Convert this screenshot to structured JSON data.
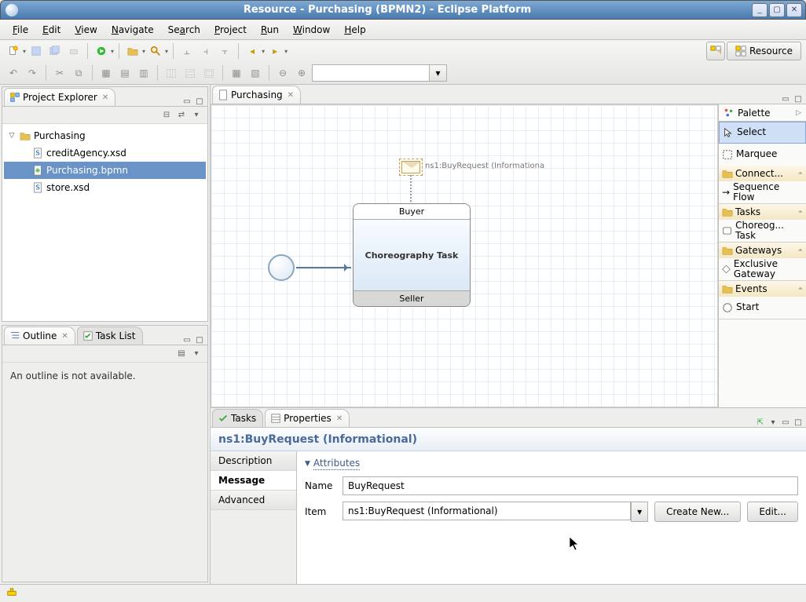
{
  "window": {
    "title": "Resource - Purchasing (BPMN2) - Eclipse Platform"
  },
  "menu": {
    "file": "File",
    "edit": "Edit",
    "view": "View",
    "navigate": "Navigate",
    "search": "Search",
    "project": "Project",
    "run": "Run",
    "window": "Window",
    "help": "Help"
  },
  "perspective": {
    "label": "Resource"
  },
  "projectExplorer": {
    "title": "Project Explorer",
    "root": "Purchasing",
    "files": [
      "creditAgency.xsd",
      "Purchasing.bpmn",
      "store.xsd"
    ],
    "selected_index": 1
  },
  "outline": {
    "title": "Outline",
    "taskListTab": "Task List",
    "empty_text": "An outline is not available."
  },
  "editor": {
    "title": "Purchasing",
    "message_label": "ns1:BuyRequest (Informationa",
    "top_band": "Buyer",
    "task_label": "Choreography Task",
    "bottom_band": "Seller"
  },
  "palette": {
    "title": "Palette",
    "select": "Select",
    "marquee": "Marquee",
    "drawers": {
      "connectors": "Connect...",
      "seqflow": "Sequence Flow",
      "tasks": "Tasks",
      "choreo": "Choreog... Task",
      "gateways": "Gateways",
      "exgw": "Exclusive Gateway",
      "events": "Events",
      "start": "Start"
    }
  },
  "bottom": {
    "tasksTab": "Tasks",
    "propsTab": "Properties",
    "header": "ns1:BuyRequest (Informational)",
    "cats": {
      "description": "Description",
      "message": "Message",
      "advanced": "Advanced"
    },
    "section": "Attributes",
    "name_label": "Name",
    "name_value": "BuyRequest",
    "item_label": "Item",
    "item_value": "ns1:BuyRequest (Informational)",
    "create_btn": "Create New...",
    "edit_btn": "Edit..."
  }
}
